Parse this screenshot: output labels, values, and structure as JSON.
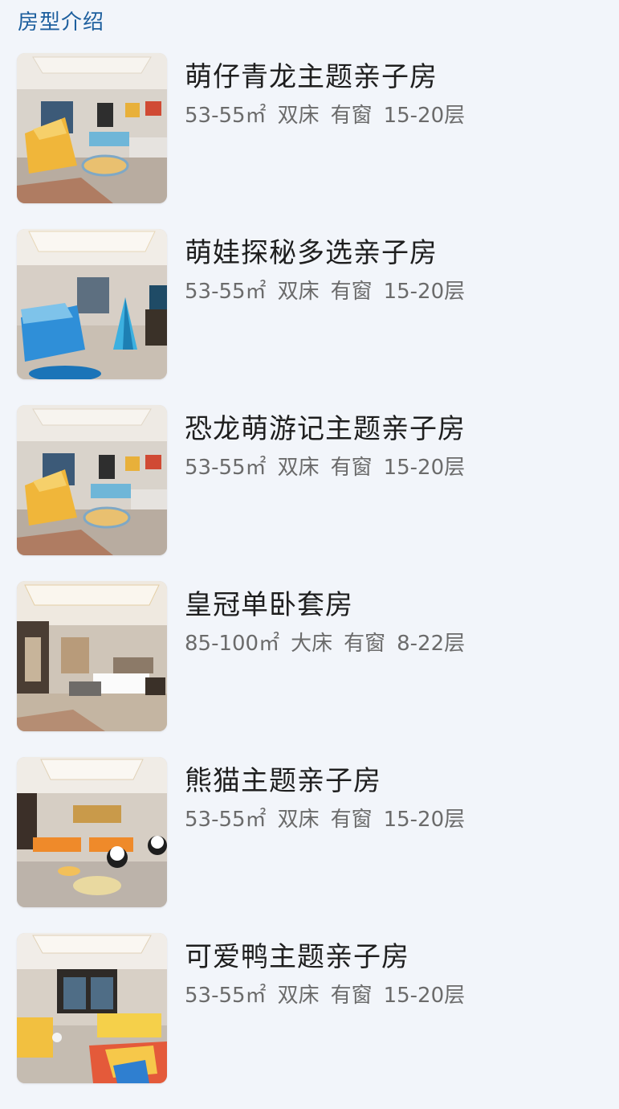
{
  "section": {
    "title": "房型介绍"
  },
  "rooms": [
    {
      "name": "萌仔青龙主题亲子房",
      "area": "53-55㎡",
      "bed": "双床",
      "window": "有窗",
      "floor": "15-20层",
      "theme": "dragon"
    },
    {
      "name": "萌娃探秘多选亲子房",
      "area": "53-55㎡",
      "bed": "双床",
      "window": "有窗",
      "floor": "15-20层",
      "theme": "explore"
    },
    {
      "name": "恐龙萌游记主题亲子房",
      "area": "53-55㎡",
      "bed": "双床",
      "window": "有窗",
      "floor": "15-20层",
      "theme": "dragon"
    },
    {
      "name": "皇冠单卧套房",
      "area": "85-100㎡",
      "bed": "大床",
      "window": "有窗",
      "floor": "8-22层",
      "theme": "suite"
    },
    {
      "name": "熊猫主题亲子房",
      "area": "53-55㎡",
      "bed": "双床",
      "window": "有窗",
      "floor": "15-20层",
      "theme": "panda"
    },
    {
      "name": "可爱鸭主题亲子房",
      "area": "53-55㎡",
      "bed": "双床",
      "window": "有窗",
      "floor": "15-20层",
      "theme": "duck"
    }
  ]
}
